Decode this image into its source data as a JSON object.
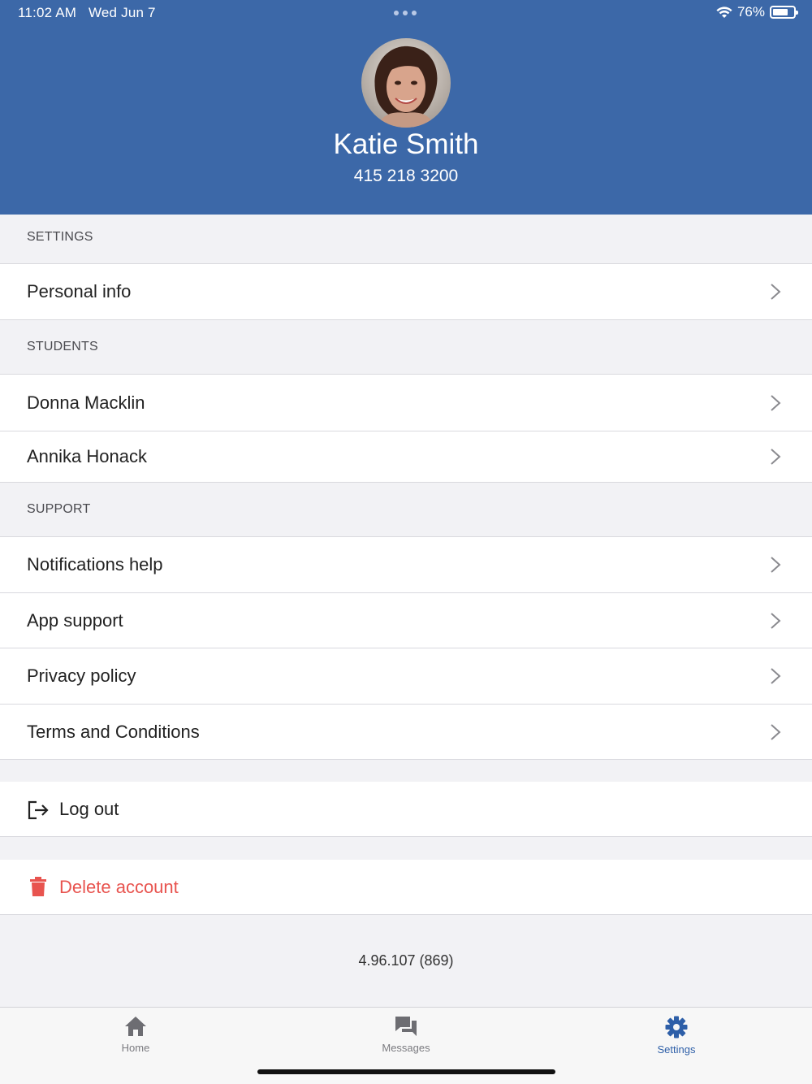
{
  "status_bar": {
    "time": "11:02 AM",
    "date": "Wed Jun 7",
    "battery": "76%",
    "battery_level": 0.76
  },
  "profile": {
    "name": "Katie Smith",
    "phone": "415 218 3200"
  },
  "sections": {
    "settings": {
      "title": "SETTINGS",
      "items": [
        "Personal info"
      ]
    },
    "students": {
      "title": "STUDENTS",
      "items": [
        "Donna Macklin",
        "Annika Honack"
      ]
    },
    "support": {
      "title": "SUPPORT",
      "items": [
        "Notifications help",
        "App support",
        "Privacy policy",
        "Terms and Conditions"
      ]
    }
  },
  "actions": {
    "logout": "Log out",
    "delete_account": "Delete account"
  },
  "version": "4.96.107 (869)",
  "tabs": [
    {
      "label": "Home",
      "icon": "home-icon",
      "active": false
    },
    {
      "label": "Messages",
      "icon": "messages-icon",
      "active": false
    },
    {
      "label": "Settings",
      "icon": "gear-icon",
      "active": true
    }
  ],
  "colors": {
    "header": "#3c68a8",
    "accent": "#2e5fa8",
    "danger": "#e8544f"
  }
}
